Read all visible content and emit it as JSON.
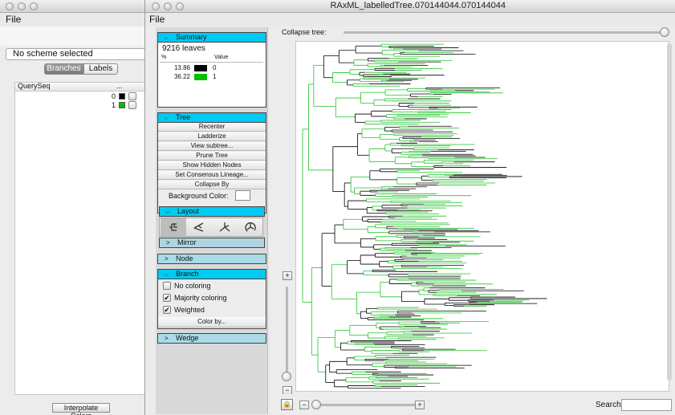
{
  "back_window": {
    "menu_file": "File",
    "scheme": "No scheme selected",
    "tabs": [
      "Branches",
      "Labels"
    ],
    "table": {
      "headers": [
        "QuerySeq",
        "..."
      ],
      "rows": [
        {
          "label": "0",
          "color": "#000000"
        },
        {
          "label": "1",
          "color": "#00c000"
        }
      ]
    },
    "interpolate_button": "Interpolate Colors"
  },
  "front_window": {
    "title": "RAxML_labelledTree.070144044.070144044",
    "menu_file": "File",
    "summary": {
      "header": "Summary",
      "leaves": "9216 leaves",
      "col_percent": "%",
      "col_value": "Value",
      "rows": [
        {
          "pct": "13.86",
          "color": "#000000",
          "value": "0"
        },
        {
          "pct": "36.22",
          "color": "#00c000",
          "value": "1"
        }
      ]
    },
    "tree": {
      "header": "Tree",
      "buttons": [
        "Recenter",
        "Ladderize",
        "View subtree...",
        "Prune Tree",
        "Show Hidden Nodes",
        "Set Consensus Lineage...",
        "Collapse By"
      ],
      "background_color_label": "Background Color:"
    },
    "layout": {
      "header": "Layout",
      "icons": [
        "rectangular-layout-icon",
        "triangular-layout-icon",
        "radial-layout-icon",
        "circular-layout-icon"
      ],
      "mirror": "Mirror"
    },
    "node": {
      "header": "Node"
    },
    "branch": {
      "header": "Branch",
      "options": [
        {
          "label": "No coloring",
          "checked": false
        },
        {
          "label": "Majority coloring",
          "checked": true
        },
        {
          "label": "Weighted",
          "checked": true
        }
      ],
      "color_by": "Color by..."
    },
    "wedge": {
      "header": "Wedge"
    },
    "collapse_tree_label": "Collapse tree:",
    "collapse_tree_level": 1.0,
    "zoom_in": "+",
    "zoom_out": "−",
    "search_label": "Search:",
    "search_value": ""
  }
}
